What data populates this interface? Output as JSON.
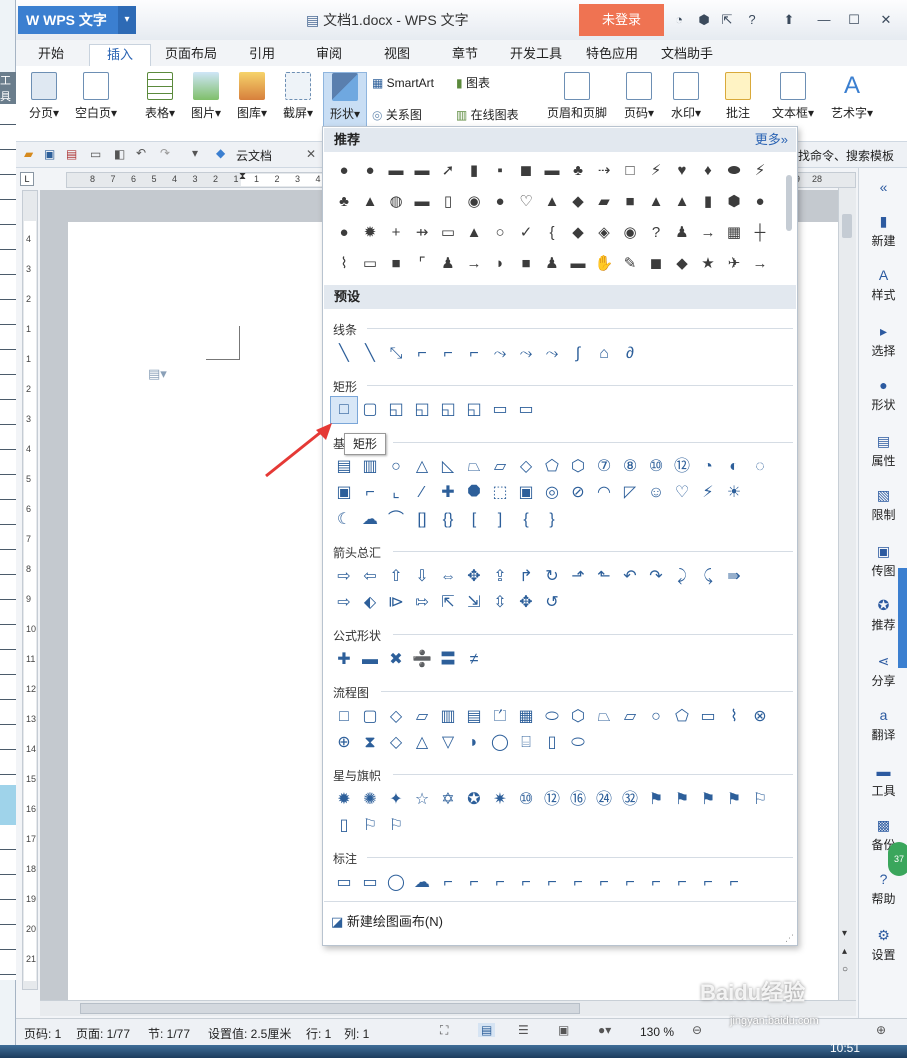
{
  "app": {
    "name": "WPS 文字",
    "title": "文档1.docx - WPS 文字",
    "login": "未登录"
  },
  "tabs": [
    "开始",
    "插入",
    "页面布局",
    "引用",
    "审阅",
    "视图",
    "章节",
    "开发工具",
    "特色应用",
    "文档助手"
  ],
  "ribbon": {
    "page_break": "分页",
    "blank_page": "空白页",
    "table": "表格",
    "picture": "图片",
    "gallery": "图库",
    "screenshot": "截屏",
    "shapes": "形状",
    "smartart": "SmartArt",
    "chart": "图表",
    "relation": "关系图",
    "online_chart": "在线图表",
    "header_footer": "页眉和页脚",
    "page_number": "页码",
    "watermark": "水印",
    "comment": "批注",
    "textbox": "文本框",
    "wordart": "艺术字"
  },
  "qat": {
    "cloud": "云文档",
    "search": "找命令、搜索模板"
  },
  "left_cut": "工具",
  "dropdown": {
    "recommended": "推荐",
    "more": "更多»",
    "presets": "预设",
    "groups": {
      "lines": "线条",
      "rect": "矩形",
      "basic": "基本形状",
      "arrows": "箭头总汇",
      "equation": "公式形状",
      "flowchart": "流程图",
      "stars": "星与旗帜",
      "callouts": "标注"
    },
    "new_canvas": "新建绘图画布(N)",
    "tooltip": "矩形"
  },
  "taskpane": [
    "新建",
    "样式",
    "选择",
    "形状",
    "属性",
    "限制",
    "传图",
    "推荐",
    "分享",
    "翻译",
    "工具",
    "备份",
    "帮助",
    "设置"
  ],
  "status": {
    "page": "页码: 1",
    "pages": "页面: 1/77",
    "section": "节: 1/77",
    "setting": "设置值: 2.5厘米",
    "row": "行: 1",
    "col": "列: 1",
    "zoom": "130 %"
  },
  "clock": "10:51",
  "watermark": {
    "logo": "Baidu经验",
    "url": "jingyan.baidu.com"
  },
  "hruler_ticks": [
    "8",
    "7",
    "6",
    "5",
    "4",
    "3",
    "2",
    "1",
    "1",
    "2",
    "3",
    "4",
    "5",
    "6",
    "7",
    "8",
    "29",
    "28"
  ],
  "vruler_ticks": [
    "4",
    "3",
    "2",
    "1",
    "1",
    "2",
    "3",
    "4",
    "5",
    "6",
    "7",
    "8",
    "9",
    "10",
    "11",
    "12",
    "13",
    "14",
    "15",
    "16",
    "17",
    "18",
    "19",
    "20",
    "21"
  ],
  "colors": {
    "accent": "#3b7fd0",
    "login": "#ef7352",
    "shape_line": "#2d5f9a"
  }
}
